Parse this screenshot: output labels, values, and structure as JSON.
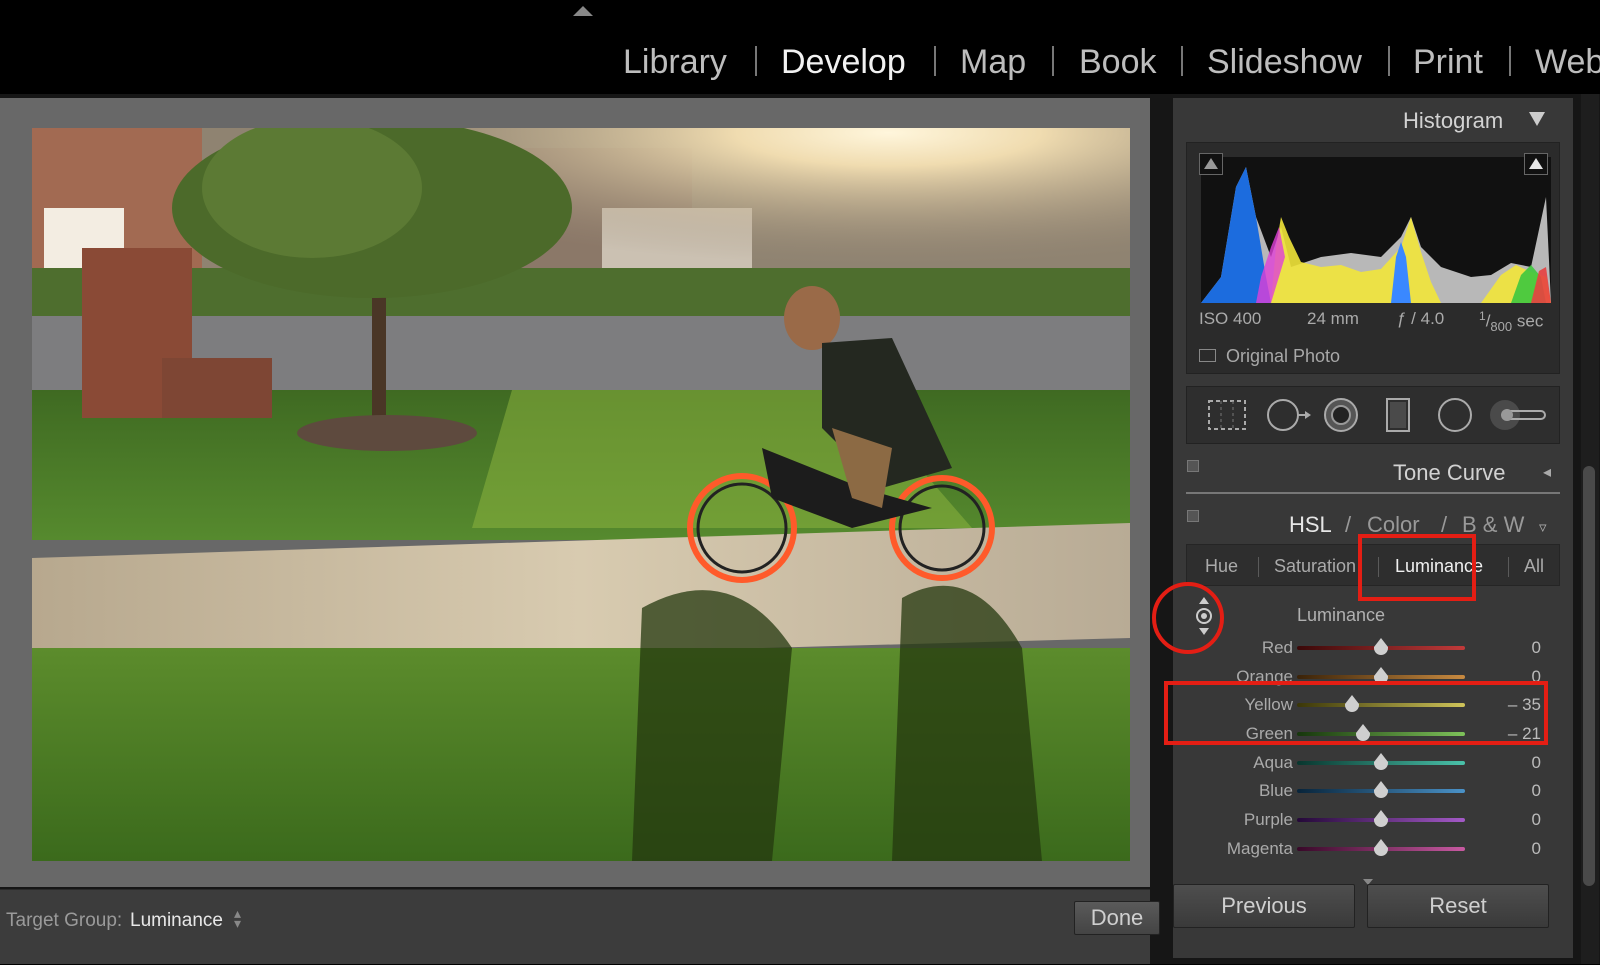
{
  "modules": {
    "items": [
      {
        "label": "Library",
        "active": false
      },
      {
        "label": "Develop",
        "active": true
      },
      {
        "label": "Map",
        "active": false
      },
      {
        "label": "Book",
        "active": false
      },
      {
        "label": "Slideshow",
        "active": false
      },
      {
        "label": "Print",
        "active": false
      },
      {
        "label": "Web",
        "active": false
      }
    ]
  },
  "toolbar": {
    "target_group_label": "Target Group:",
    "target_group_value": "Luminance",
    "done_label": "Done"
  },
  "histogram": {
    "title": "Histogram",
    "iso": "ISO 400",
    "focal": "24 mm",
    "aperture": "ƒ / 4.0",
    "shutter_num": "1",
    "shutter_den": "800",
    "shutter_unit": "sec",
    "original_photo_label": "Original Photo"
  },
  "tone_curve": {
    "title": "Tone Curve"
  },
  "hsl": {
    "hsl_label": "HSL",
    "color_label": "Color",
    "bw_label": "B & W",
    "slash": "/",
    "tabs": [
      {
        "label": "Hue",
        "active": false
      },
      {
        "label": "Saturation",
        "active": false
      },
      {
        "label": "Luminance",
        "active": true
      },
      {
        "label": "All",
        "active": false
      }
    ],
    "section_title": "Luminance",
    "sliders": [
      {
        "label": "Red",
        "value": "0",
        "amount": 0,
        "track": "linear-gradient(90deg,#3a0808,#c23a3a)"
      },
      {
        "label": "Orange",
        "value": "0",
        "amount": 0,
        "track": "linear-gradient(90deg,#3a2208,#c88a40)"
      },
      {
        "label": "Yellow",
        "value": "– 35",
        "amount": -35,
        "track": "linear-gradient(90deg,#3a3608,#cfc45a)"
      },
      {
        "label": "Green",
        "value": "– 21",
        "amount": -21,
        "track": "linear-gradient(90deg,#16360c,#7ec25a)"
      },
      {
        "label": "Aqua",
        "value": "0",
        "amount": 0,
        "track": "linear-gradient(90deg,#08362e,#4ac2aa)"
      },
      {
        "label": "Blue",
        "value": "0",
        "amount": 0,
        "track": "linear-gradient(90deg,#08243a,#4a92c8)"
      },
      {
        "label": "Purple",
        "value": "0",
        "amount": 0,
        "track": "linear-gradient(90deg,#240838,#a45ac8)"
      },
      {
        "label": "Magenta",
        "value": "0",
        "amount": 0,
        "track": "linear-gradient(90deg,#380828,#c85aa2)"
      }
    ]
  },
  "buttons": {
    "previous": "Previous",
    "reset": "Reset"
  },
  "colors": {
    "annotation_red": "#e41e14",
    "panel_bg": "#383838"
  }
}
